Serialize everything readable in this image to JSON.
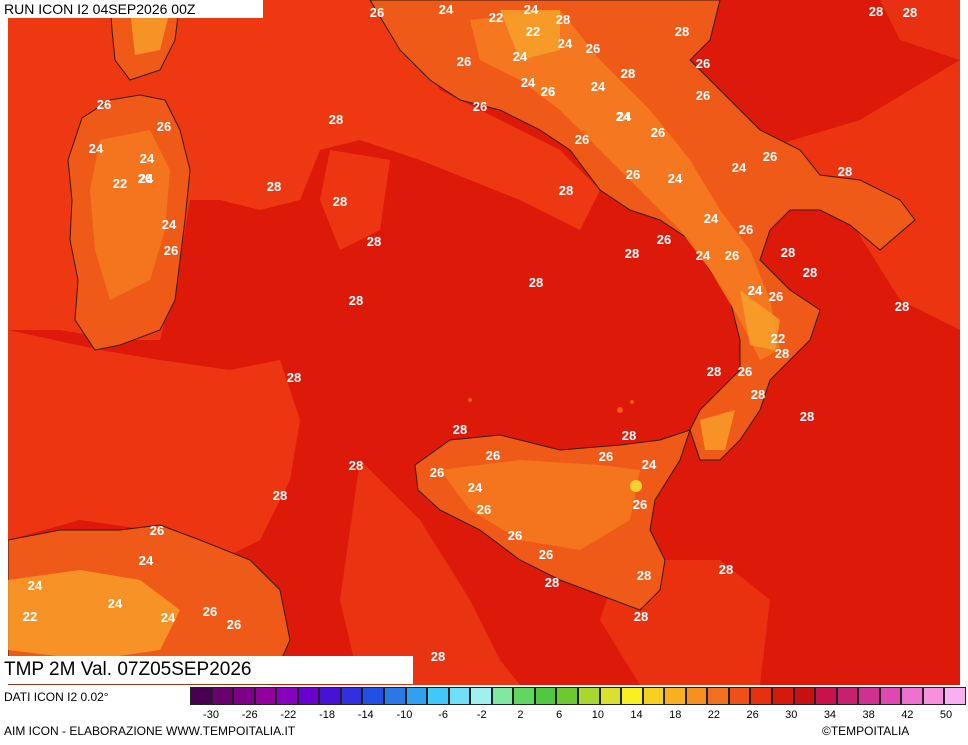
{
  "run_label": "RUN ICON I2 04SEP2026 00Z",
  "valid_label": "TMP 2M Val. 07Z05SEP2026",
  "data_source": "DATI ICON I2 0.02°",
  "credit": "AIM ICON - ELABORAZIONE WWW.TEMPOITALIA.IT",
  "brand": "©TEMPOITALIA",
  "colors": {
    "sea_warm": "#dd1a0a",
    "sea_mid": "#ee3a12",
    "land": "#f05a18",
    "land_cool": "#f57a20",
    "land_cold": "#f7a02a",
    "hot_spot": "#f8d030",
    "coast": "#3a1a10"
  },
  "legend": {
    "colors": [
      "#4a0050",
      "#6a0070",
      "#7e0088",
      "#92009e",
      "#8800c0",
      "#6a00d0",
      "#4a10d8",
      "#3030e0",
      "#2050e8",
      "#2a78e8",
      "#30a0f0",
      "#40c8f8",
      "#70e0f8",
      "#a0f0f0",
      "#80e8a0",
      "#60d860",
      "#50c840",
      "#70c830",
      "#a8d830",
      "#d8e030",
      "#f8f020",
      "#f8d020",
      "#f8b020",
      "#f89020",
      "#f07020",
      "#f05018",
      "#e83010",
      "#d81808",
      "#c81010",
      "#c8104a",
      "#c82070",
      "#d03090",
      "#e048b0",
      "#f070d0",
      "#f890e0",
      "#f8b0f0"
    ],
    "ticks": [
      "-30",
      "-26",
      "-22",
      "-18",
      "-14",
      "-10",
      "-6",
      "-2",
      "2",
      "6",
      "10",
      "14",
      "18",
      "22",
      "26",
      "30",
      "34",
      "38",
      "42",
      "50"
    ]
  },
  "map_labels": [
    {
      "t": "28"
    },
    {
      "t": "28"
    },
    {
      "t": "26"
    },
    {
      "t": "24"
    },
    {
      "t": "22"
    },
    {
      "t": "24"
    },
    {
      "t": "28"
    },
    {
      "t": "22"
    },
    {
      "t": "24"
    },
    {
      "t": "26"
    },
    {
      "t": "28"
    },
    {
      "t": "26"
    },
    {
      "t": "24"
    },
    {
      "t": "24"
    },
    {
      "t": "26"
    },
    {
      "t": "26"
    },
    {
      "t": "28"
    },
    {
      "t": "24"
    },
    {
      "t": "26"
    },
    {
      "t": "26"
    },
    {
      "t": "24"
    },
    {
      "t": "26"
    },
    {
      "t": "28"
    },
    {
      "t": "26"
    },
    {
      "t": "28"
    },
    {
      "t": "24"
    },
    {
      "t": "26"
    },
    {
      "t": "24"
    },
    {
      "t": "28"
    },
    {
      "t": "24"
    },
    {
      "t": "26"
    },
    {
      "t": "24"
    },
    {
      "t": "26"
    },
    {
      "t": "28"
    },
    {
      "t": "26"
    },
    {
      "t": "24"
    },
    {
      "t": "26"
    },
    {
      "t": "28"
    },
    {
      "t": "28"
    },
    {
      "t": "24"
    },
    {
      "t": "26"
    },
    {
      "t": "28"
    },
    {
      "t": "28"
    },
    {
      "t": "28"
    },
    {
      "t": "22"
    },
    {
      "t": "28"
    },
    {
      "t": "28"
    },
    {
      "t": "26"
    },
    {
      "t": "24"
    },
    {
      "t": "28"
    },
    {
      "t": "28"
    },
    {
      "t": "28"
    },
    {
      "t": "26"
    },
    {
      "t": "24"
    },
    {
      "t": "24"
    },
    {
      "t": "26"
    },
    {
      "t": "26"
    },
    {
      "t": "22"
    },
    {
      "t": "24"
    },
    {
      "t": "26"
    },
    {
      "t": "24"
    },
    {
      "t": "28"
    },
    {
      "t": "28"
    },
    {
      "t": "26"
    },
    {
      "t": "28"
    },
    {
      "t": "28"
    },
    {
      "t": "28"
    },
    {
      "t": "28"
    },
    {
      "t": "26"
    },
    {
      "t": "26"
    },
    {
      "t": "28"
    },
    {
      "t": "26"
    },
    {
      "t": "24"
    },
    {
      "t": "26"
    },
    {
      "t": "24"
    },
    {
      "t": "26"
    },
    {
      "t": "26"
    },
    {
      "t": "26"
    },
    {
      "t": "28"
    },
    {
      "t": "28"
    },
    {
      "t": "28"
    },
    {
      "t": "28"
    },
    {
      "t": "26"
    },
    {
      "t": "24"
    },
    {
      "t": "24"
    },
    {
      "t": "22"
    },
    {
      "t": "28"
    },
    {
      "t": "24"
    },
    {
      "t": "24"
    },
    {
      "t": "26"
    },
    {
      "t": "26"
    },
    {
      "t": "28"
    }
  ]
}
